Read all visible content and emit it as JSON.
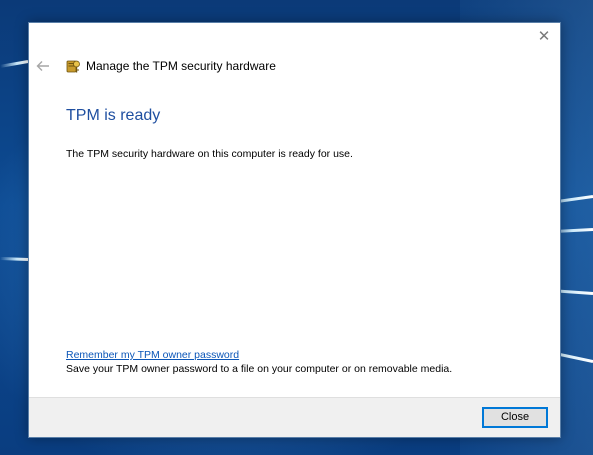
{
  "window": {
    "close_glyph": "✕"
  },
  "header": {
    "title": "Manage the TPM security hardware",
    "back_icon": "back-arrow-icon",
    "app_icon": "tpm-chip-icon"
  },
  "main": {
    "heading": "TPM is ready",
    "description": "The TPM security hardware on this computer is ready for use."
  },
  "owner_password": {
    "link_text": "Remember my TPM owner password",
    "description": "Save your TPM owner password to a file on your computer or on removable media."
  },
  "footer": {
    "close_label": "Close"
  },
  "colors": {
    "heading": "#1f4fa0",
    "link": "#0b56b8",
    "button_border": "#0078d7",
    "footer_bg": "#f0f0f0"
  }
}
